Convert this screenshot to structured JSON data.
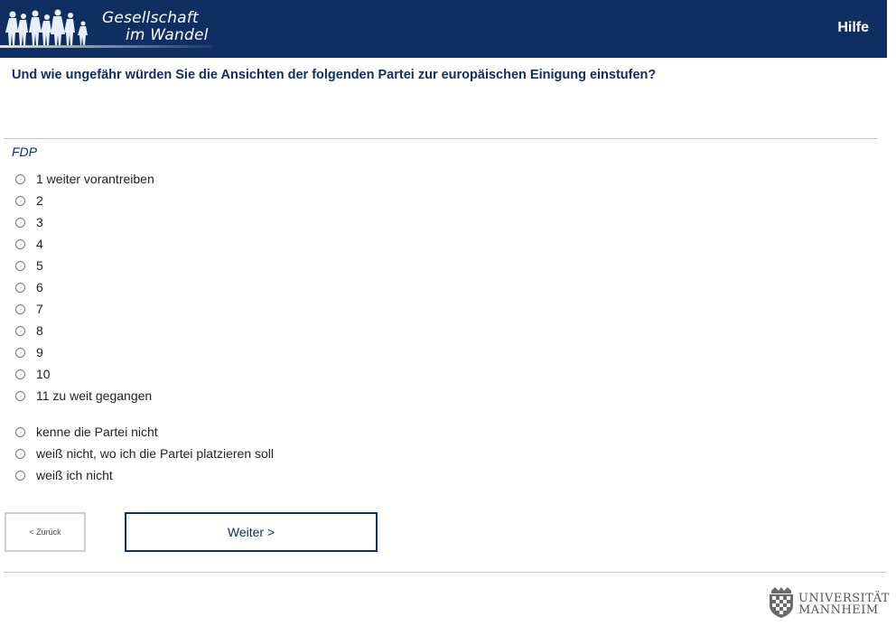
{
  "header": {
    "logo_line1": "Gesellschaft",
    "logo_line2": "im Wandel",
    "help_label": "Hilfe",
    "background_color": "#0f2f63"
  },
  "question": {
    "text": "Und wie ungefähr würden Sie die Ansichten der folgenden Partei zur europäischen Einigung einstufen?",
    "item_label": "FDP"
  },
  "options": [
    {
      "label": "1 weiter vorantreiben",
      "selected": false
    },
    {
      "label": "2",
      "selected": false
    },
    {
      "label": "3",
      "selected": false
    },
    {
      "label": "4",
      "selected": false
    },
    {
      "label": "5",
      "selected": false
    },
    {
      "label": "6",
      "selected": false
    },
    {
      "label": "7",
      "selected": false
    },
    {
      "label": "8",
      "selected": false
    },
    {
      "label": "9",
      "selected": false
    },
    {
      "label": "10",
      "selected": false
    },
    {
      "label": "11 zu weit gegangen",
      "selected": false
    },
    {
      "label": "kenne die Partei nicht",
      "selected": false
    },
    {
      "label": "weiß nicht, wo ich die Partei platzieren soll",
      "selected": false
    },
    {
      "label": "weiß ich nicht",
      "selected": false
    }
  ],
  "navigation": {
    "back_label": "< Zurück",
    "next_label": "Weiter >"
  },
  "footer": {
    "university_line1": "UNIVERSITÄT",
    "university_line2": "MANNHEIM",
    "logo_icon": "university-crest-icon"
  }
}
